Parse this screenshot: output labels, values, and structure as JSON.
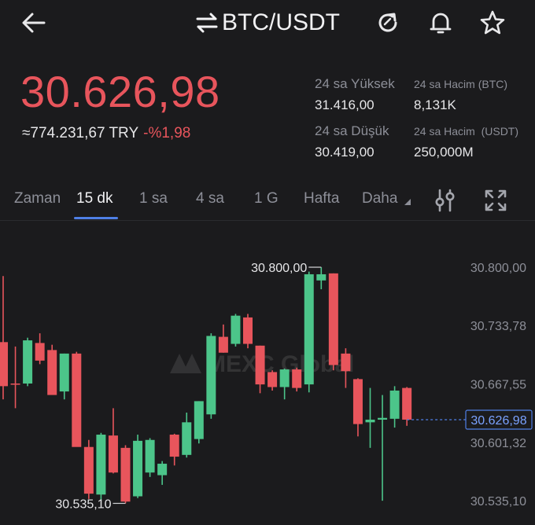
{
  "header": {
    "pair": "BTC/USDT",
    "icons": [
      "back-arrow-icon",
      "swap-icon",
      "refresh-icon",
      "bell-icon",
      "star-icon"
    ]
  },
  "ticker": {
    "price": "30.626,98",
    "try_value": "≈774.231,67 TRY",
    "change": "-%1,98",
    "high_label": "24 sa Yüksek",
    "high_value": "31.416,00",
    "vol_btc_label": "24 sa Hacim (BTC)",
    "vol_btc_value": "8,131K",
    "low_label": "24 sa Düşük",
    "low_value": "30.419,00",
    "vol_usdt_label": "24 sa Hacim  (USDT)",
    "vol_usdt_value": "250,000M"
  },
  "tabs": {
    "items": [
      "Zaman",
      "15 dk",
      "1 sa",
      "4 sa",
      "1 G",
      "Hafta",
      "Daha"
    ],
    "active": "15 dk"
  },
  "colors": {
    "up": "#4cc58a",
    "down": "#e8555c",
    "accent": "#4f7fe6",
    "background": "#1b1b1d"
  },
  "chart_data": {
    "type": "candlestick",
    "y_axis_labels": [
      "30.800,00",
      "30.733,78",
      "30.667,55",
      "30.601,32",
      "30.535,10"
    ],
    "ylim": [
      30520,
      30860
    ],
    "high_marker": "30.800,00",
    "low_marker": "30.535,10",
    "last_price": "30.626,98",
    "watermark": "MEXC Global",
    "candles": [
      {
        "o": 30715,
        "h": 30790,
        "l": 30650,
        "c": 30665
      },
      {
        "o": 30668,
        "h": 30710,
        "l": 30640,
        "c": 30667
      },
      {
        "o": 30668,
        "h": 30720,
        "l": 30665,
        "c": 30717
      },
      {
        "o": 30714,
        "h": 30725,
        "l": 30690,
        "c": 30694
      },
      {
        "o": 30706,
        "h": 30712,
        "l": 30656,
        "c": 30655
      },
      {
        "o": 30659,
        "h": 30702,
        "l": 30650,
        "c": 30702
      },
      {
        "o": 30702,
        "h": 30704,
        "l": 30597,
        "c": 30596
      },
      {
        "o": 30596,
        "h": 30604,
        "l": 30537,
        "c": 30543
      },
      {
        "o": 30542,
        "h": 30612,
        "l": 30535,
        "c": 30610
      },
      {
        "o": 30609,
        "h": 30640,
        "l": 30566,
        "c": 30567
      },
      {
        "o": 30595,
        "h": 30598,
        "l": 30532,
        "c": 30534
      },
      {
        "o": 30540,
        "h": 30610,
        "l": 30538,
        "c": 30603
      },
      {
        "o": 30567,
        "h": 30606,
        "l": 30562,
        "c": 30604
      },
      {
        "o": 30564,
        "h": 30580,
        "l": 30553,
        "c": 30577
      },
      {
        "o": 30610,
        "h": 30611,
        "l": 30575,
        "c": 30585
      },
      {
        "o": 30587,
        "h": 30635,
        "l": 30584,
        "c": 30624
      },
      {
        "o": 30605,
        "h": 30648,
        "l": 30600,
        "c": 30648
      },
      {
        "o": 30633,
        "h": 30725,
        "l": 30628,
        "c": 30722
      },
      {
        "o": 30721,
        "h": 30735,
        "l": 30703,
        "c": 30703
      },
      {
        "o": 30713,
        "h": 30747,
        "l": 30710,
        "c": 30745
      },
      {
        "o": 30743,
        "h": 30747,
        "l": 30708,
        "c": 30713
      },
      {
        "o": 30711,
        "h": 30711,
        "l": 30657,
        "c": 30667
      },
      {
        "o": 30681,
        "h": 30683,
        "l": 30660,
        "c": 30664
      },
      {
        "o": 30664,
        "h": 30685,
        "l": 30650,
        "c": 30684
      },
      {
        "o": 30684,
        "h": 30686,
        "l": 30659,
        "c": 30663
      },
      {
        "o": 30667,
        "h": 30795,
        "l": 30658,
        "c": 30792
      },
      {
        "o": 30785,
        "h": 30800,
        "l": 30775,
        "c": 30792
      },
      {
        "o": 30793,
        "h": 30793,
        "l": 30683,
        "c": 30689
      },
      {
        "o": 30702,
        "h": 30708,
        "l": 30663,
        "c": 30682
      },
      {
        "o": 30673,
        "h": 30674,
        "l": 30608,
        "c": 30622
      },
      {
        "o": 30624,
        "h": 30663,
        "l": 30595,
        "c": 30627
      },
      {
        "o": 30627,
        "h": 30655,
        "l": 30535,
        "c": 30629
      },
      {
        "o": 30628,
        "h": 30665,
        "l": 30618,
        "c": 30660
      },
      {
        "o": 30663,
        "h": 30664,
        "l": 30620,
        "c": 30627
      }
    ]
  }
}
